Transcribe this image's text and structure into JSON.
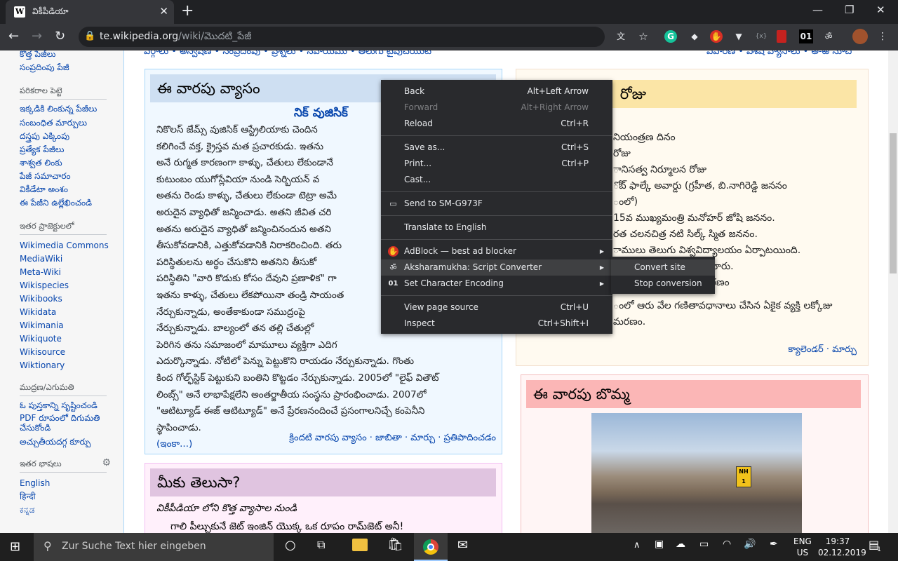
{
  "browser": {
    "tab_title": "వికీపీడియా",
    "tab_favicon": "W",
    "url_host": "te.wikipedia.org",
    "url_path": "/wiki/మొదటి_పేజీ"
  },
  "extensions": {
    "ext_badge_01": "01"
  },
  "sidebar": {
    "top_links": [
      "కొత్త పేజీలు",
      "సంప్రదింపు పేజీ"
    ],
    "tools_heading": "పరికరాల పెట్టె",
    "tools": [
      "ఇక్కడికి లింకున్న పేజీలు",
      "సంబంధిత మార్పులు",
      "దస్త్రపు ఎక్కింపు",
      "ప్రత్యేక పేజీలు",
      "శాశ్వత లింకు",
      "పేజీ సమాచారం",
      "వికీడేటా అంశం",
      "ఈ పేజీని ఉల్లేఖించండి"
    ],
    "projects_heading": "ఇతర ప్రాజెక్టులలో",
    "projects": [
      "Wikimedia Commons",
      "MediaWiki",
      "Meta-Wiki",
      "Wikispecies",
      "Wikibooks",
      "Wikidata",
      "Wikimania",
      "Wikiquote",
      "Wikisource",
      "Wiktionary"
    ],
    "print_heading": "ముద్రణ/ఎగుమతి",
    "print": [
      "ఓ పుస్తకాన్ని సృష్టించండి",
      "PDF రూపంలో దిగుమతి చేసుకోండి",
      "అచ్చుతీయదగ్గ కూర్పు"
    ],
    "lang_heading": "ఇతర భాషలు",
    "langs": [
      "English",
      "हिन्दी",
      "ಕನ್ನಡ"
    ]
  },
  "main": {
    "top_nav_left": "వర్గాలు • అన్వేషణ • సంప్రదింపు • ప్రశ్నలు • సహాయము • తెలుగు టైపుచేయుట",
    "top_nav_right": "విహారిణి • విశేష వ్యాసాలు • అ-ఱ సూచి",
    "article_heading": "ఈ వారపు వ్యాసం",
    "article_title": "నిక్ వుజిసిక్",
    "article_lines": [
      "నికొలస్ జేమ్స్ వుజిసిక్ ఆస్ట్రేలియాకు చెందిన",
      "కలిగించే వక్త, క్రైస్తవ మత ప్రచారకుడు. ఇతను",
      "అనే రుగ్మత కారణంగా కాళ్ళు, చేతులు లేకుండానే",
      "కుటుంబం యుగోస్లేవియా నుండి సెర్బియన్ వ",
      "అతను రెండు కాళ్ళు, చేతులు లేకుండా టెట్రా అమే",
      "అరుదైన వ్యాధితో జన్మించాడు. అతని జీవిత చరి",
      "అతను అరుదైన వ్యాధితో జన్మించినందున అతని",
      "తీసుకోవడానికి, ఎత్తుకోవడానికి నిరాకరించింది. తరు",
      "పరిస్థితులను అర్థం చేసుకొని అతనిని తీసుకో",
      "పరిస్థితిని \"వారి కొడుకు కోసం దేవుని ప్రణాళిక\" గా",
      "ఇతను కాళ్ళు, చేతులు లేకపోయినా తండ్రి సాయంత",
      "నేర్చుకున్నాడు, అంతేకాకుండా సముద్రంపై",
      "నేర్చుకున్నాడు. బాల్యంలో తన తల్లి చేతుల్లో",
      "పెరిగిన తను సమాజంలో మామూలు వ్యక్తిగా ఎదిగ",
      "ఎదుర్కొన్నాడు. నోటిలో పెన్ను పెట్టుకొని రాయడం నేర్చుకున్నాడు. గొంతు",
      "కింద గోల్ఫ్‌స్టిక్ పెట్టుకుని బంతిని కొట్టడం నేర్చుకున్నాడు. 2005లో \"లైఫ్ వితౌట్",
      "లింబ్స్\" అనే లాభాపేక్షలేని అంతర్జాతీయ సంస్థను ప్రారంభించాడు. 2007లో",
      "\"ఆటిట్యూడ్ ఈజ్ ఆటిట్యూడ్\" అనే ప్రేరణనందించే ప్రసంగాలనిచ్చే కంపెనీని",
      "స్థాపించాడు."
    ],
    "article_more": "(ఇంకా...)",
    "article_footer": "క్రిందటి వారపు వ్యాసం · జాబితా · మార్చు · ప్రతిపాదించడం",
    "dyk_heading": "మీకు తెలుసా?",
    "dyk_sub": "వికీపీడియా లోని కొత్త వ్యాసాల నుండి",
    "dyk_item": "గాలి పీల్చుకునే జెట్ ఇంజిన్ యొక్క ఒక రూపం రామ్‌జెట్ అనీ!",
    "day_heading_suffix": "రోజు",
    "day_lines": [
      "నియంత్రణ దినం",
      "రోజు",
      "ానిసత్వ నిర్మూలన రోజు",
      "ోబ్ ఫాల్కే అవార్డు (గ్రహీత, బి.నాగిరెడ్డి జననం",
      "ంలో)",
      "15వ ముఖ్యమంత్రి మనోహర్ జోషి జననం.",
      "రత చలనచిత్ర నటి సిల్క్ స్మిత జననం.",
      "ాములు తెలుగు విశ్వవిద్యాలయం ఏర్పాటయింది.",
      "ర వి.పి.సింగ్ నియమితులైనారు.",
      "ిచేసిన మర్రి చెన్నారెడ్డి మరణం",
      "ంలో ఆరు వేల గణితావధానాలు చేసిన ఏకైక వ్యక్తి లక్కోజు",
      "మరణం."
    ],
    "day_footer": "క్యాలెండర్ · మార్చు",
    "photo_heading": "ఈ వారపు బొమ్మ",
    "road_sign": "NH 1"
  },
  "context_menu": {
    "items": [
      {
        "label": "Back",
        "shortcut": "Alt+Left Arrow"
      },
      {
        "label": "Forward",
        "shortcut": "Alt+Right Arrow"
      },
      {
        "label": "Reload",
        "shortcut": "Ctrl+R"
      },
      {
        "label": "Save as...",
        "shortcut": "Ctrl+S"
      },
      {
        "label": "Print...",
        "shortcut": "Ctrl+P"
      },
      {
        "label": "Cast..."
      },
      {
        "label": "Send to SM-G973F"
      },
      {
        "label": "Translate to English"
      },
      {
        "label": "AdBlock — best ad blocker"
      },
      {
        "label": "Aksharamukha: Script Converter"
      },
      {
        "label": "Set Character Encoding",
        "icon_text": "01"
      },
      {
        "label": "View page source",
        "shortcut": "Ctrl+U"
      },
      {
        "label": "Inspect",
        "shortcut": "Ctrl+Shift+I"
      }
    ],
    "submenu": [
      "Convert site",
      "Stop conversion"
    ]
  },
  "taskbar": {
    "search_placeholder": "Zur Suche Text hier eingeben",
    "lang_top": "ENG",
    "lang_bottom": "US",
    "time": "19:37",
    "date": "02.12.2019",
    "notif_count": "1"
  },
  "colors": {
    "article_bg": "#f0f8ff",
    "article_border": "#a7d7f9",
    "article_hdr": "#cedff2",
    "day_bg": "#fffaf0",
    "day_hdr": "#fbe5a6",
    "photo_hdr": "#fbb6b6",
    "dyk_bg": "#fff0fb",
    "dyk_hdr": "#e0c4e0"
  }
}
